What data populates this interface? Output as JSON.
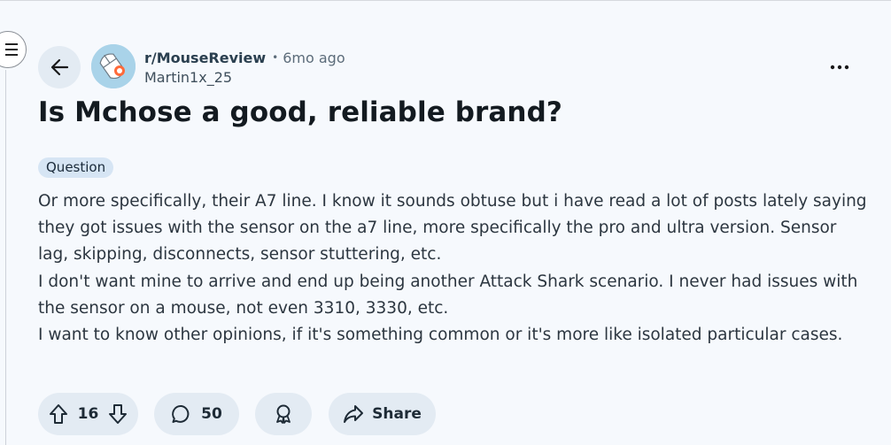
{
  "post": {
    "subreddit": "r/MouseReview",
    "separator": "•",
    "time_ago": "6mo ago",
    "author": "Martin1x_25",
    "title": "Is Mchose a good, reliable brand?",
    "flair": "Question",
    "body": [
      "Or more specifically, their A7 line. I know it sounds obtuse but i have read a lot of posts lately saying they got issues with the sensor on the a7 line, more specifically the pro and ultra version. Sensor lag, skipping, disconnects, sensor stuttering, etc.",
      "I don't want mine to arrive and end up being another Attack Shark scenario. I never had issues with the sensor on a mouse, not even 3310, 3330, etc.",
      "I want to know other opinions, if it's something common or it's more like isolated particular cases."
    ]
  },
  "actions": {
    "vote_count": "16",
    "comment_count": "50",
    "share_label": "Share"
  },
  "icons": {
    "menu": "hamburger-icon",
    "back": "arrow-left-icon",
    "more": "more-horizontal-icon",
    "upvote": "arrow-up-icon",
    "downvote": "arrow-down-icon",
    "comment": "comment-bubble-icon",
    "award": "award-icon",
    "share": "share-arrow-icon"
  },
  "colors": {
    "background": "#f6f9fd",
    "pill": "#e3ebf3",
    "flair": "#d6e5f4",
    "avatar": "#a9d3e9"
  }
}
